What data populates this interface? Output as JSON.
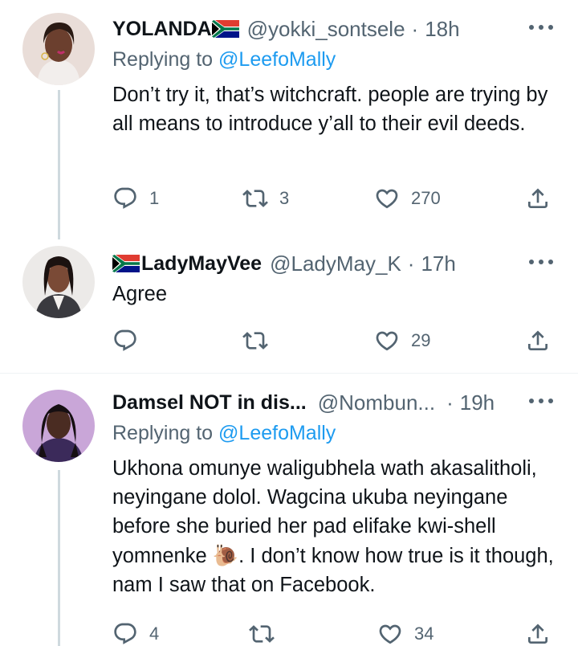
{
  "tweets": [
    {
      "name": "YOLANDA",
      "handle": "@yokki_sontsele",
      "separator_dot": "·",
      "time": "18h",
      "reply_prefix": "Replying to ",
      "reply_mention": "@LeefoMally",
      "body": "Don’t try it, that’s witchcraft. people are trying by all means to introduce y’all to their evil deeds.",
      "reply_count": "1",
      "retweet_count": "3",
      "like_count": "270"
    },
    {
      "name": "LadyMayVee",
      "handle": "@LadyMay_K",
      "separator_dot": "·",
      "time": "17h",
      "body": "Agree",
      "reply_count": "",
      "retweet_count": "",
      "like_count": "29"
    },
    {
      "name": "Damsel NOT in dis...",
      "handle": "@Nombun...",
      "separator_dot": "·",
      "time": "19h",
      "reply_prefix": "Replying to ",
      "reply_mention": "@LeefoMally",
      "body_part1": "Ukhona omunye waligubhela wath akasalitholi, neyingane dolol. Wagcina ukuba neyingane before she buried her pad elifake kwi-shell yomnenke ",
      "body_emoji": "🐌",
      "body_part2": ". I don’t know how true is it though, nam I saw that on Facebook.",
      "reply_count": "4",
      "retweet_count": "",
      "like_count": "34"
    }
  ],
  "icons": {
    "reply": "reply-icon",
    "retweet": "retweet-icon",
    "like": "like-icon",
    "share": "share-icon",
    "more": "more-icon",
    "flag": "south-africa-flag-icon"
  },
  "colors": {
    "text": "#0f1419",
    "secondary": "#536471",
    "link": "#1d9bf0",
    "thread_line": "#cfd9de"
  }
}
